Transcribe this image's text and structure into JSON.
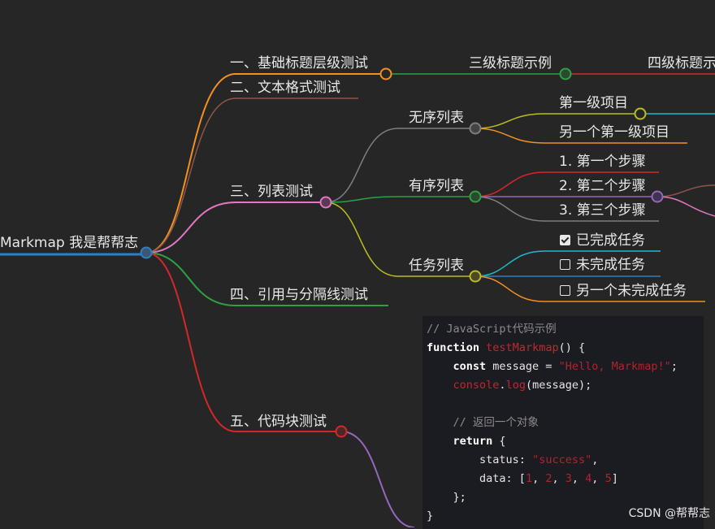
{
  "root": {
    "label": "Markmap 我是帮帮志"
  },
  "branches": {
    "b1": "一、基础标题层级测试",
    "b1_h3": "三级标题示例",
    "b1_h4": "四级标题示",
    "b2": "二、文本格式测试",
    "b3": "三、列表测试",
    "b3_ul": "无序列表",
    "b3_ul_1": "第一级项目",
    "b3_ul_2": "另一个第一级项目",
    "b3_ol": "有序列表",
    "b3_ol_1": "1. 第一个步骤",
    "b3_ol_2": "2. 第二个步骤",
    "b3_ol_3": "3. 第三个步骤",
    "b3_task": "任务列表",
    "b3_task_1": "已完成任务",
    "b3_task_2": "未完成任务",
    "b3_task_3": "另一个未完成任务",
    "b4": "四、引用与分隔线测试",
    "b5": "五、代码块测试"
  },
  "code": {
    "comment1": "// JavaScript代码示例",
    "kw_function": "function",
    "fn_name": "testMarkmap",
    "sig_rest": "() {",
    "kw_const": "const",
    "var_message": " message = ",
    "str_hello": "\"Hello, Markmap!\"",
    "semi": ";",
    "console": "console",
    "dot": ".",
    "log": "log",
    "log_args": "(message);",
    "comment2": "// 返回一个对象",
    "kw_return": "return",
    "brace_open": " {",
    "status_key": "status: ",
    "str_success": "\"success\"",
    "comma": ",",
    "data_key": "data: [",
    "n1": "1",
    "n2": "2",
    "n3": "3",
    "n4": "4",
    "n5": "5",
    "sep": ", ",
    "bracket_close": "]",
    "obj_close": "};",
    "fn_close": "}"
  },
  "watermark": "CSDN @帮帮志",
  "colors": {
    "root": "#2f7fc1",
    "b1": "#f2911f",
    "b1_h3": "#2ea043",
    "b1_h4": "#c9302c",
    "b2": "#8c564b",
    "b3": "#e377c2",
    "b3_ul": "#7f7f7f",
    "b3_ul_1": "#bcbd22",
    "b3_ul_1_sub": "#17becf",
    "b3_ul_2": "#f2911f",
    "b3_ol": "#2ea043",
    "b3_ol_1": "#d62728",
    "b3_ol_2": "#9467bd",
    "b3_ol_2_sub1": "#8c564b",
    "b3_ol_2_sub2": "#e377c2",
    "b3_ol_3": "#7f7f7f",
    "b3_task": "#bcbd22",
    "b3_task_1": "#17becf",
    "b3_task_2": "#2f7fc1",
    "b3_task_3": "#f2911f",
    "b4": "#2ea043",
    "b5": "#d62728",
    "b5_sub": "#9467bd"
  }
}
